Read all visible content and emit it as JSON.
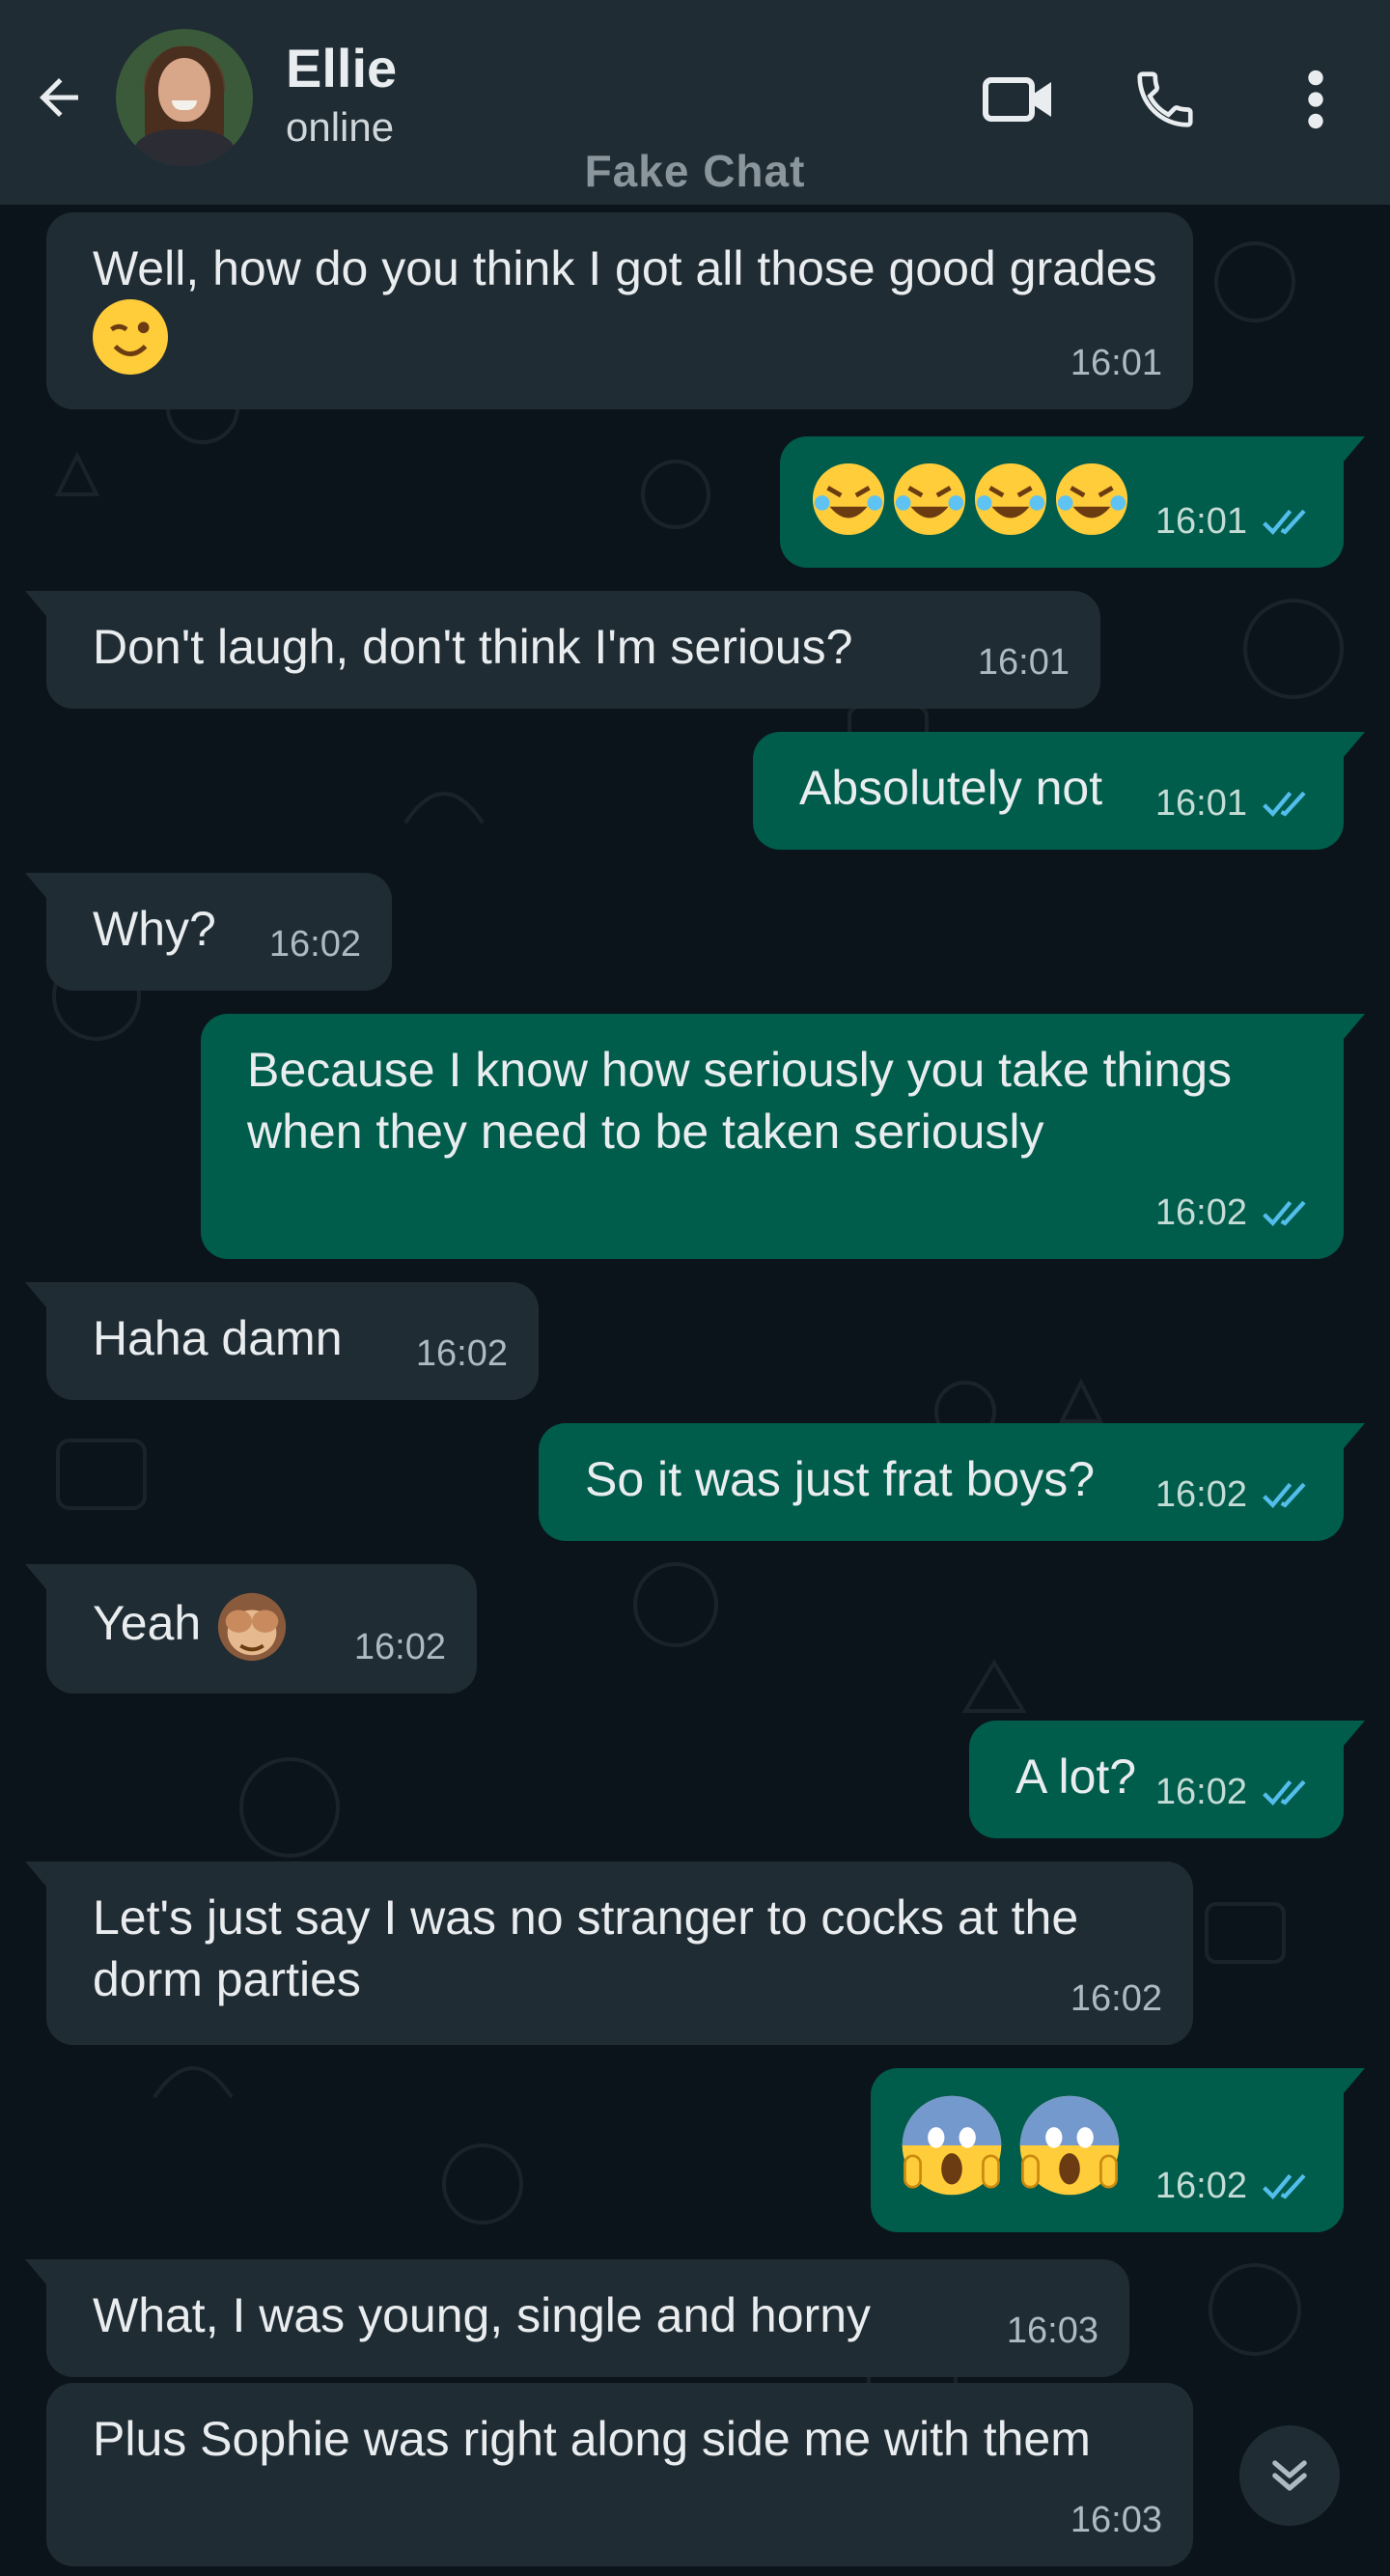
{
  "header": {
    "contact_name": "Ellie",
    "contact_status": "online",
    "watermark": "Fake Chat",
    "icons": [
      "back-arrow-icon",
      "video-call-icon",
      "phone-icon",
      "more-vertical-icon"
    ]
  },
  "colors": {
    "header_bg": "#1f2c34",
    "chat_bg": "#0b141a",
    "incoming_bubble": "#202c33",
    "outgoing_bubble": "#005c4b",
    "read_ticks": "#53bdeb"
  },
  "messages": [
    {
      "dir": "in",
      "text": "Well, how do you think I got all those good grades",
      "emoji": "wink",
      "time": "16:01"
    },
    {
      "dir": "out",
      "text": "",
      "emoji": "rofl x4",
      "time": "16:01",
      "read": true
    },
    {
      "dir": "in",
      "text": "Don't laugh, don't think I'm serious?",
      "time": "16:01"
    },
    {
      "dir": "out",
      "text": "Absolutely not",
      "time": "16:01",
      "read": true
    },
    {
      "dir": "in",
      "text": "Why?",
      "time": "16:02"
    },
    {
      "dir": "out",
      "text": "Because I know how seriously you take things when they need to be taken seriously",
      "time": "16:02",
      "read": true
    },
    {
      "dir": "in",
      "text": "Haha damn",
      "time": "16:02"
    },
    {
      "dir": "out",
      "text": "So it was just frat boys?",
      "time": "16:02",
      "read": true
    },
    {
      "dir": "in",
      "text": "Yeah",
      "emoji": "see-no-evil-monkey",
      "time": "16:02"
    },
    {
      "dir": "out",
      "text": "A lot?",
      "time": "16:02",
      "read": true
    },
    {
      "dir": "in",
      "text": "Let's just say I was no stranger to cocks at the dorm parties",
      "time": "16:02"
    },
    {
      "dir": "out",
      "text": "",
      "emoji": "screaming-face x2",
      "time": "16:02",
      "read": true
    },
    {
      "dir": "in",
      "text": "What, I was young, single and horny",
      "time": "16:03"
    },
    {
      "dir": "in",
      "text": "Plus Sophie was right along side me with them",
      "time": "16:03"
    }
  ],
  "scroll_down_icon": "double-chevron-down-icon"
}
